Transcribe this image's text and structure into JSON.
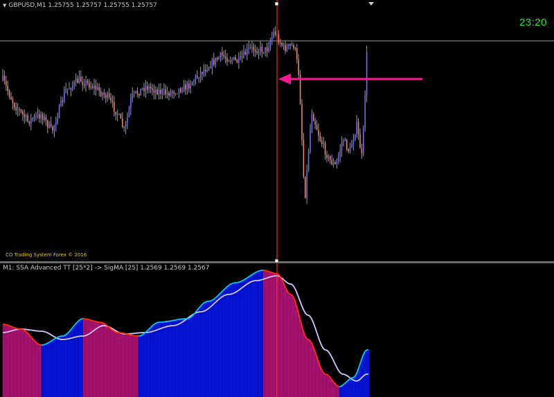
{
  "chart": {
    "symbol_label": "GBPUSD,M1  1.25755 1.25757 1.25755 1.25757",
    "time_label": "23:20",
    "copyright": "CO Trading System Forex © 2016",
    "indicator_label": "M1: SSA Advanced TT [25*2] -> SigMA [25] 1.2569 1.2569 1.2567",
    "colors": {
      "background": "#000000",
      "bull_candle": "#6b6bff",
      "bear_candle": "#e8866b",
      "wick": "#9a9aaa",
      "cursor_line": "#ff2020",
      "arrow": "#ff1493",
      "price_line": "#9a9a9a",
      "hist_up": "#0a1ad6",
      "hist_down": "#b0207a",
      "fast_line": "#00c8ff",
      "fast_line_down": "#ff3000",
      "slow_line": "#d8c8ff",
      "clock": "#23e823",
      "copyright": "#e8c800"
    }
  }
}
